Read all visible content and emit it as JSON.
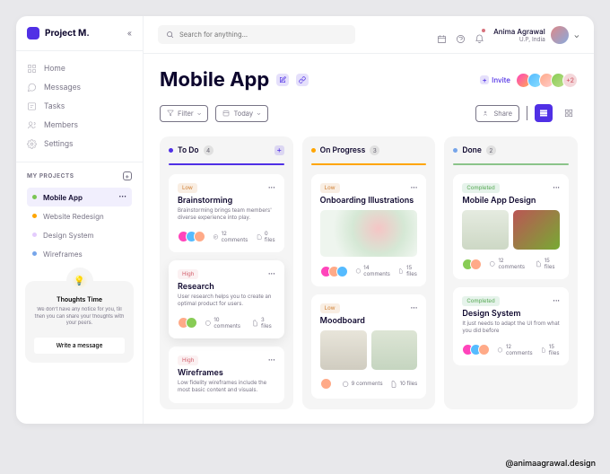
{
  "logo": "Project M.",
  "watermark": "@animaagrawal.design",
  "search": {
    "placeholder": "Search for anything..."
  },
  "user": {
    "name": "Anima Agrawal",
    "location": "U.P, India"
  },
  "nav": [
    {
      "label": "Home"
    },
    {
      "label": "Messages"
    },
    {
      "label": "Tasks"
    },
    {
      "label": "Members"
    },
    {
      "label": "Settings"
    }
  ],
  "projects_header": "MY PROJECTS",
  "projects": [
    {
      "label": "Mobile App",
      "color": "#7AC555",
      "active": true
    },
    {
      "label": "Website Redesign",
      "color": "#FFA500",
      "active": false
    },
    {
      "label": "Design System",
      "color": "#E4CCFD",
      "active": false
    },
    {
      "label": "Wireframes",
      "color": "#76A5EA",
      "active": false
    }
  ],
  "thoughts": {
    "title": "Thoughts Time",
    "body": "We don't have any notice for you, till then you can share your thoughts with your peers.",
    "cta": "Write a message"
  },
  "page": {
    "title": "Mobile App",
    "invite": "Invite",
    "filter": "Filter",
    "today": "Today",
    "share": "Share",
    "avatars_more": "+2"
  },
  "columns": [
    {
      "name": "To Do",
      "count": "4",
      "dot": "#5030E5",
      "line": "#5030E5",
      "add": true
    },
    {
      "name": "On Progress",
      "count": "3",
      "dot": "#FFA500",
      "line": "#FFA500",
      "add": false
    },
    {
      "name": "Done",
      "count": "2",
      "dot": "#76A5EA",
      "line": "#8BC48A",
      "add": false
    }
  ],
  "cards": {
    "c1": {
      "tag": "Low",
      "title": "Brainstorming",
      "desc": "Brainstorming brings team members' diverse experience into play.",
      "comments": "12 comments",
      "files": "0 files"
    },
    "c2": {
      "tag": "High",
      "title": "Research",
      "desc": "User research helps you to create an optimal product for users.",
      "comments": "10 comments",
      "files": "3 files"
    },
    "c3": {
      "tag": "High",
      "title": "Wireframes",
      "desc": "Low fidelity wireframes include the most basic content and visuals."
    },
    "c4": {
      "tag": "Low",
      "title": "Onboarding Illustrations",
      "comments": "14 comments",
      "files": "15 files"
    },
    "c5": {
      "tag": "Low",
      "title": "Moodboard",
      "comments": "9 comments",
      "files": "10 files"
    },
    "c6": {
      "tag": "Completed",
      "title": "Mobile App Design",
      "comments": "12 comments",
      "files": "15 files"
    },
    "c7": {
      "tag": "Completed",
      "title": "Design System",
      "desc": "It just needs to adapt the UI from what you did before",
      "comments": "12 comments",
      "files": "15 files"
    }
  }
}
